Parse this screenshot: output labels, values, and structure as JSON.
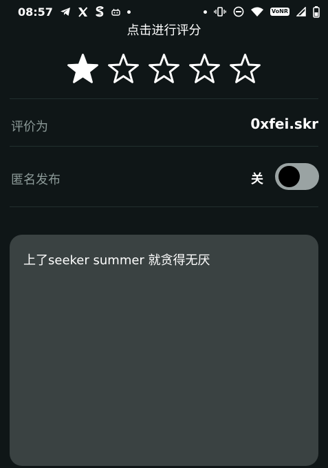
{
  "status_bar": {
    "time": "08:57",
    "left_icons": [
      "telegram-icon",
      "x-icon",
      "s-logo-icon",
      "android-icon",
      "dot-icon"
    ],
    "right_icons": [
      "dot-icon",
      "vibrate-icon",
      "do-not-disturb-icon",
      "wifi-icon",
      "volte-icon",
      "signal-icon",
      "battery-icon"
    ],
    "volte_label": "VoNR"
  },
  "rating": {
    "title": "点击进行评分",
    "value": 1,
    "max": 5
  },
  "reviewer": {
    "label": "评价为",
    "value": "0xfei.skr"
  },
  "anonymous": {
    "label": "匿名发布",
    "state_label": "关",
    "enabled": false
  },
  "comment": {
    "text": "上了seeker summer 就贪得无厌"
  },
  "colors": {
    "background": "#0f1617",
    "muted_text": "#8c9a98",
    "card": "#3a4242",
    "toggle_track": "#9aa3a3"
  }
}
